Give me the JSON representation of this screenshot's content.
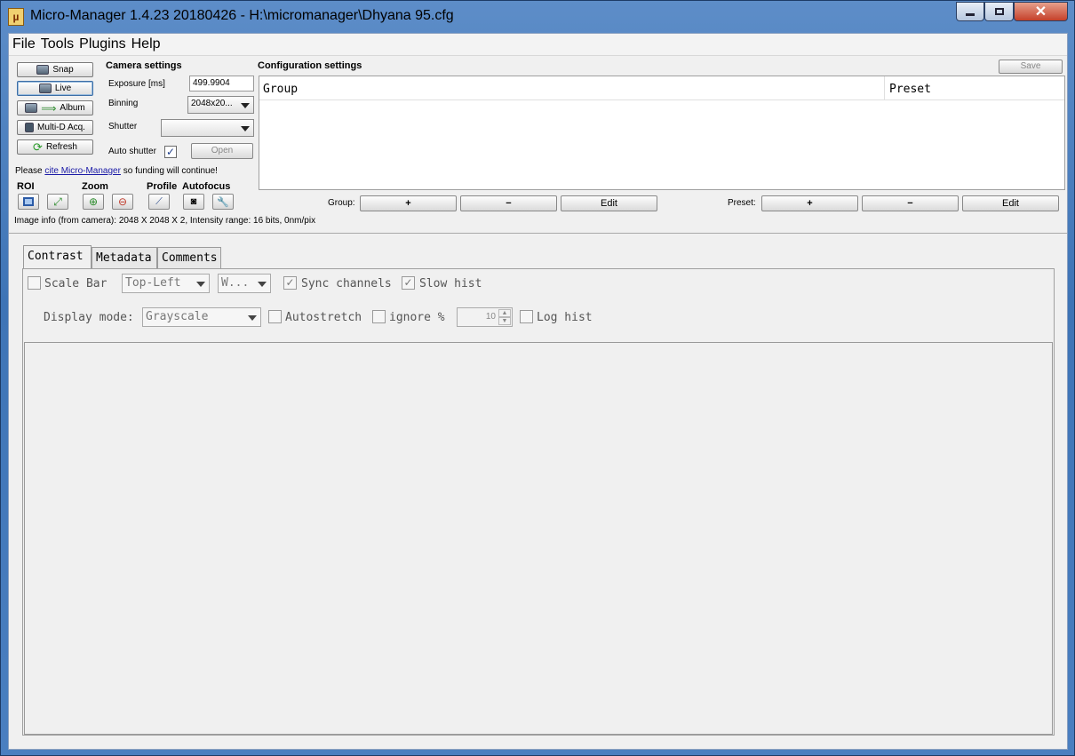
{
  "window": {
    "title": "Micro-Manager 1.4.23 20180426 - H:\\micromanager\\Dhyana 95.cfg"
  },
  "menu": {
    "file": "File",
    "tools": "Tools",
    "plugins": "Plugins",
    "help": "Help"
  },
  "actions": {
    "snap": "Snap",
    "live": "Live",
    "album": "Album",
    "multid": "Multi-D Acq.",
    "refresh": "Refresh"
  },
  "camera": {
    "heading": "Camera settings",
    "exposure_label": "Exposure [ms]",
    "exposure_value": "499.9904",
    "binning_label": "Binning",
    "binning_value": "2048x20...",
    "shutter_label": "Shutter",
    "shutter_value": "",
    "autoshutter_label": "Auto shutter",
    "autoshutter_checked": true,
    "open_label": "Open"
  },
  "cite": {
    "prefix": "Please ",
    "link": "cite Micro-Manager",
    "suffix": " so funding will continue!"
  },
  "tools": {
    "roi": "ROI",
    "zoom": "Zoom",
    "profile": "Profile",
    "autofocus": "Autofocus"
  },
  "image_info": "Image info (from camera): 2048 X 2048 X 2, Intensity range: 16 bits, 0nm/pix",
  "config": {
    "heading": "Configuration settings",
    "save": "Save",
    "col_group": "Group",
    "col_preset": "Preset",
    "group_label": "Group:",
    "preset_label": "Preset:",
    "plus": "+",
    "minus": "−",
    "edit": "Edit"
  },
  "tabs": {
    "contrast": "Contrast",
    "metadata": "Metadata",
    "comments": "Comments"
  },
  "contrast": {
    "scale_bar": "Scale Bar",
    "scale_pos": "Top-Left",
    "scale_color": "W...",
    "sync_channels": "Sync channels",
    "slow_hist": "Slow hist",
    "display_mode_label": "Display mode:",
    "display_mode": "Grayscale",
    "autostretch": "Autostretch",
    "ignore_pct": "ignore %",
    "ignore_value": "10",
    "log_hist": "Log hist"
  },
  "colors": {
    "accent": "#3c6ea6",
    "link": "#1a1aa6"
  }
}
